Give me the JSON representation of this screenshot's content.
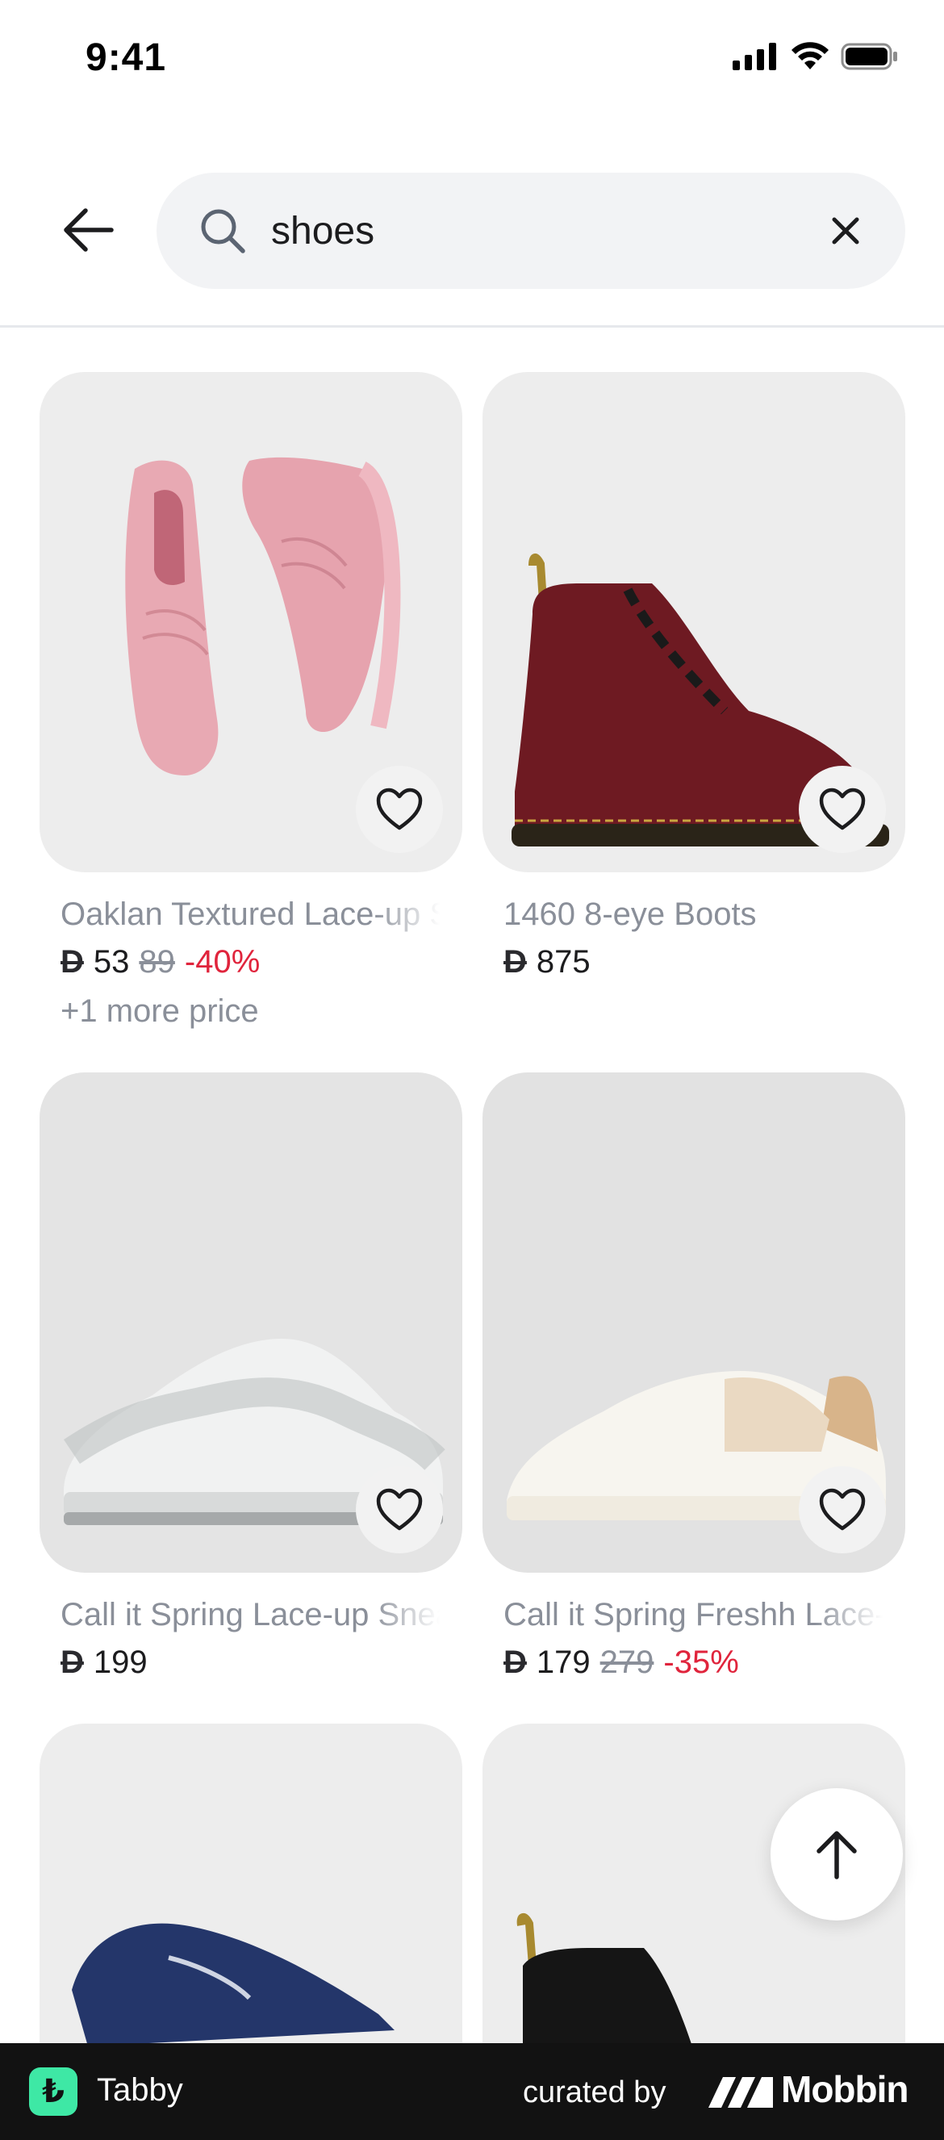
{
  "status_bar": {
    "time": "9:41"
  },
  "search": {
    "query": "shoes",
    "placeholder": "Search"
  },
  "products": [
    {
      "name": "Oaklan Textured Lace-up Sneakers",
      "currency": "D",
      "price": "53",
      "old_price": "89",
      "discount": "-40%",
      "more_price": "+1 more price",
      "image": "pink-knit-sneakers"
    },
    {
      "name": "1460 8-eye Boots",
      "currency": "D",
      "price": "875",
      "image": "burgundy-leather-boot"
    },
    {
      "name": "Call it Spring Lace-up Sneakers",
      "currency": "D",
      "price": "199",
      "image": "white-grey-sneaker"
    },
    {
      "name": "Call it Spring Freshh Lace-up Sneakers",
      "currency": "D",
      "price": "179",
      "old_price": "279",
      "discount": "-35%",
      "image": "white-beige-sneaker"
    },
    {
      "name": "",
      "image": "navy-kangaroos-sneaker"
    },
    {
      "name": "",
      "image": "black-leather-boot"
    }
  ],
  "bottom_bar": {
    "app_name": "Tabby",
    "curated_by": "curated by",
    "brand": "Mobbin"
  },
  "colors": {
    "accent_discount": "#e0243c",
    "muted_text": "#8a8f99",
    "card_bg": "#ededed",
    "tabby_green": "#3ee8a5"
  }
}
